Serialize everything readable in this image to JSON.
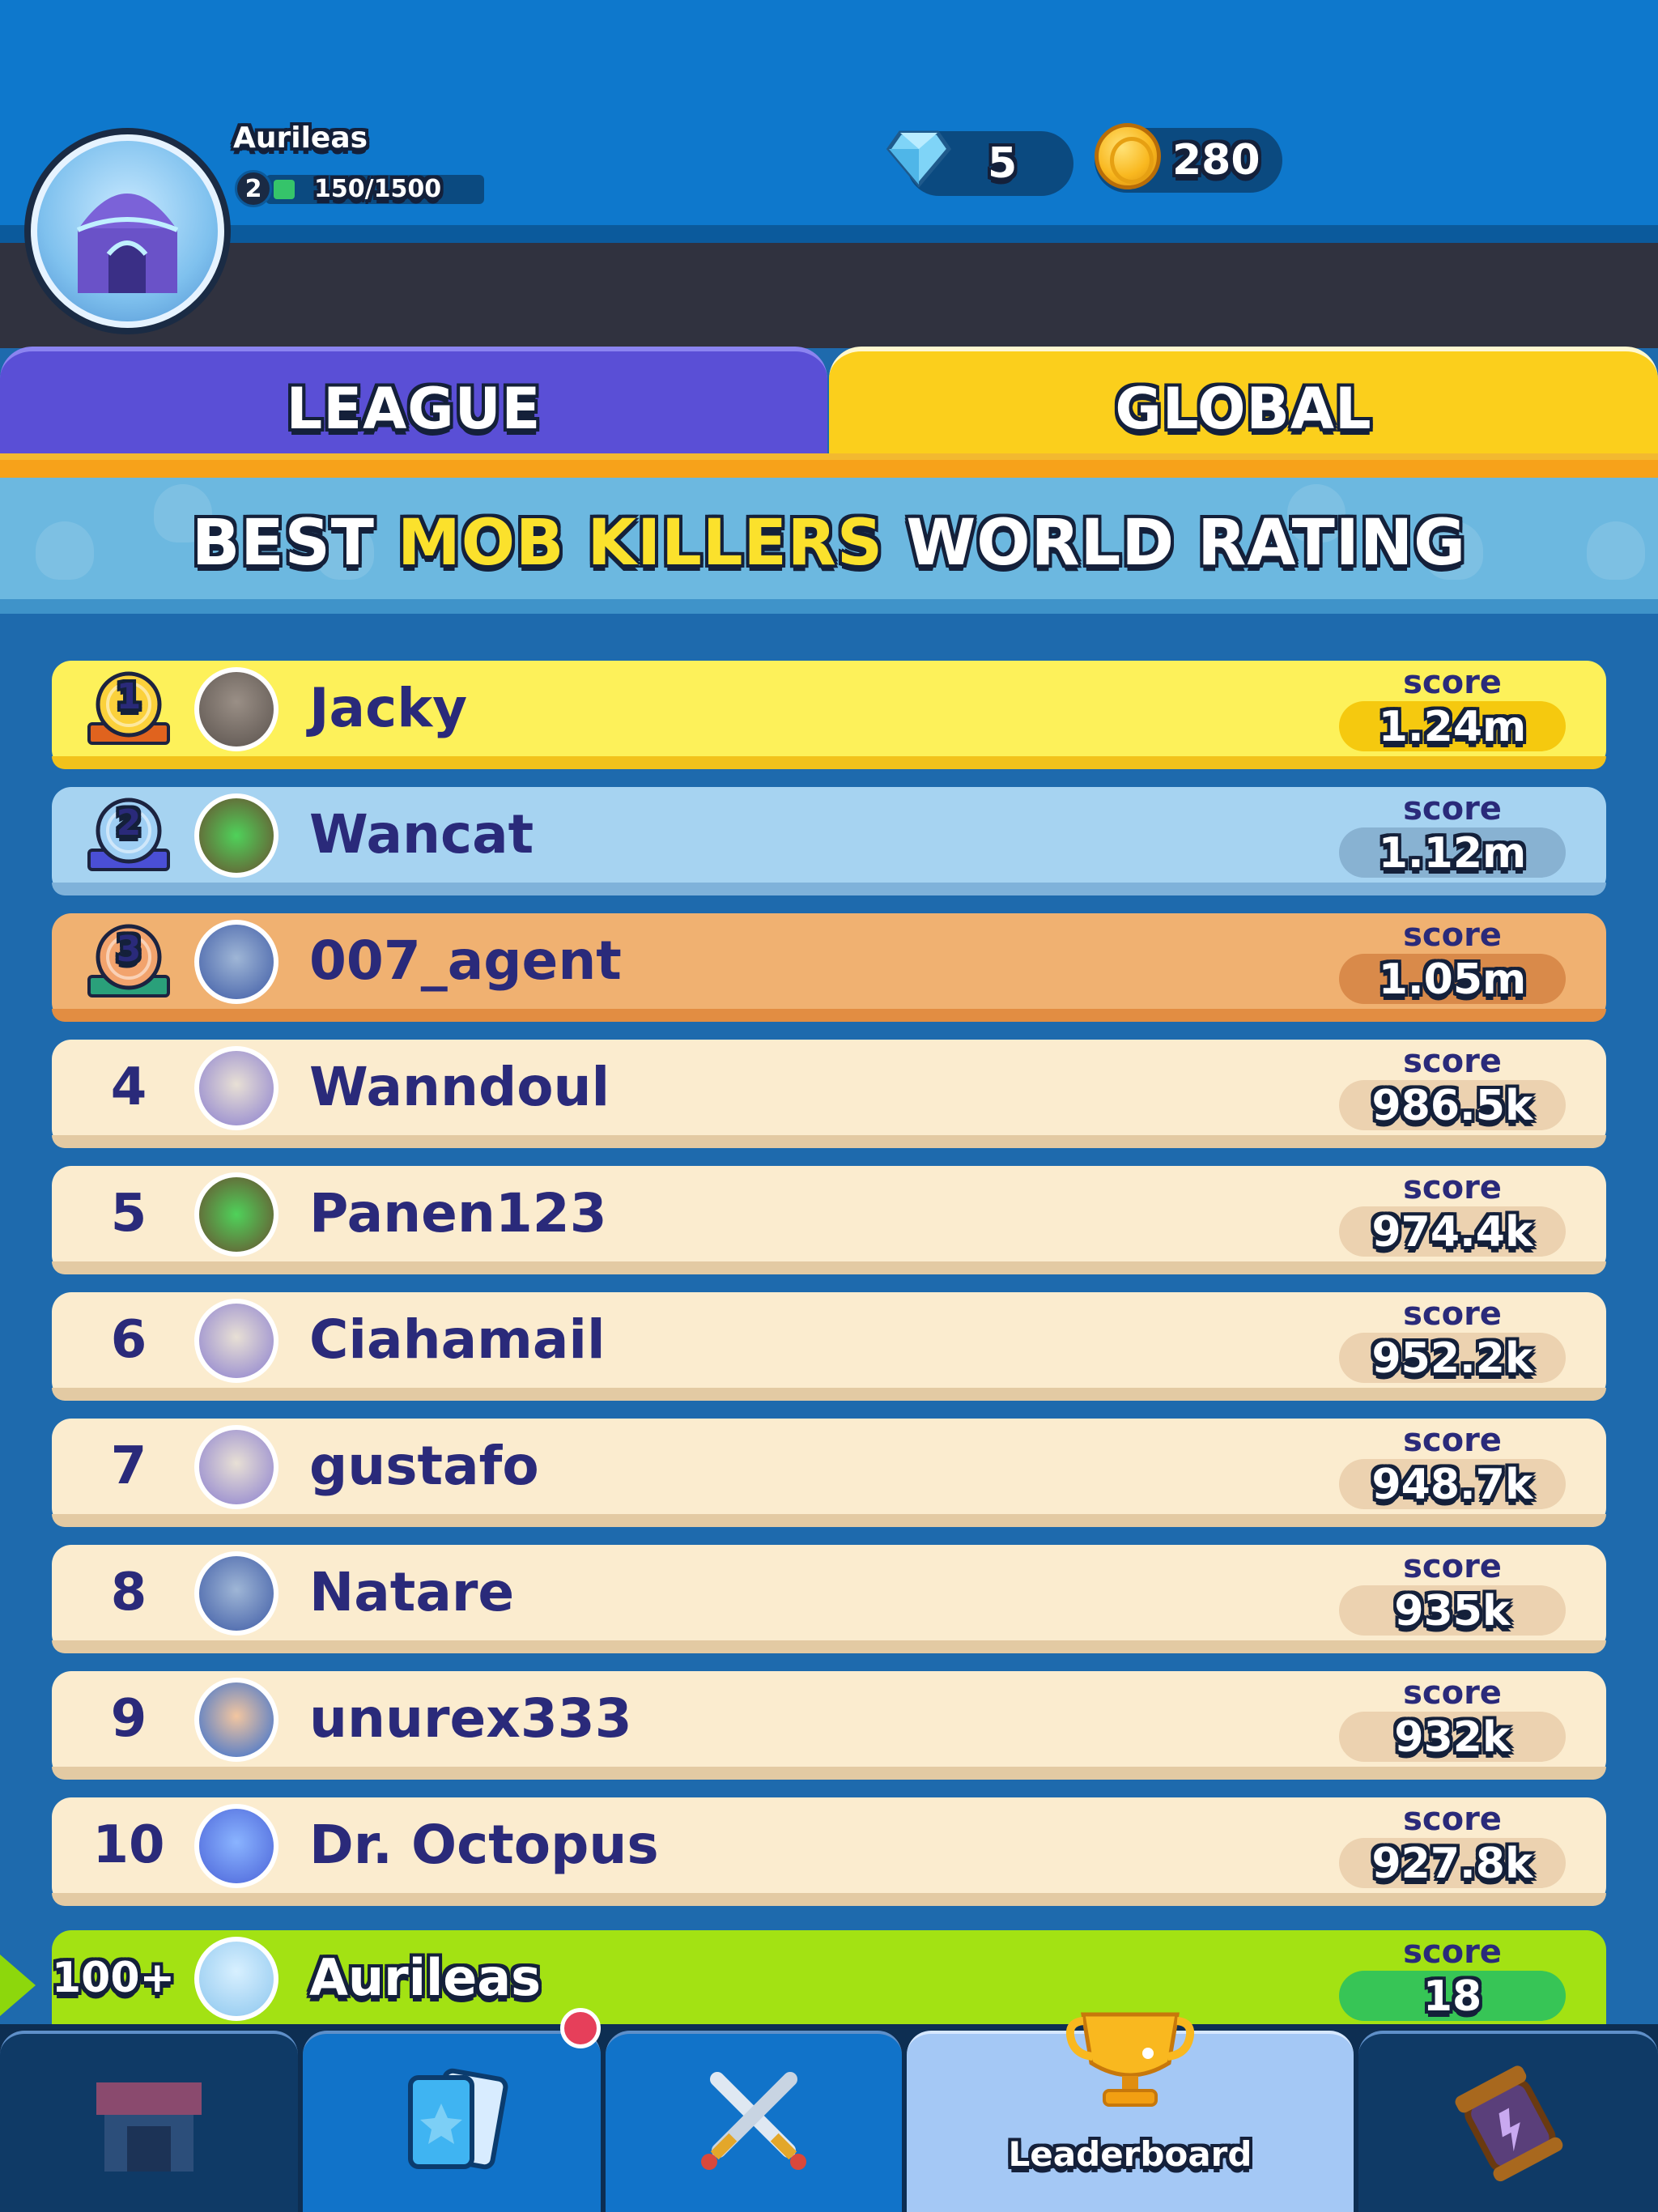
{
  "player": {
    "name": "Aurileas",
    "level": "2",
    "xp_text": "150/1500",
    "xp_progress": 0.1
  },
  "currency": {
    "gems": "5",
    "coins": "280"
  },
  "tabs": {
    "league": "LEAGUE",
    "global": "GLOBAL",
    "active": "global"
  },
  "banner": {
    "part1": "BEST",
    "highlight": "MOB KILLERS",
    "part2": "WORLD RATING"
  },
  "score_label": "score",
  "rows": [
    {
      "rank": "1",
      "name": "Jacky",
      "score": "1.24m",
      "avatar": "tower-avatar-icon"
    },
    {
      "rank": "2",
      "name": "Wancat",
      "score": "1.12m",
      "avatar": "chameleon-avatar-icon"
    },
    {
      "rank": "3",
      "name": "007_agent",
      "score": "1.05m",
      "avatar": "knight-avatar-icon"
    },
    {
      "rank": "4",
      "name": "Wanndoul",
      "score": "986.5k",
      "avatar": "scientist-avatar-icon"
    },
    {
      "rank": "5",
      "name": "Panen123",
      "score": "974.4k",
      "avatar": "chameleon-avatar-icon"
    },
    {
      "rank": "6",
      "name": "Ciahamail",
      "score": "952.2k",
      "avatar": "scientist-avatar-icon"
    },
    {
      "rank": "7",
      "name": "gustafo",
      "score": "948.7k",
      "avatar": "scientist-avatar-icon"
    },
    {
      "rank": "8",
      "name": "Natare",
      "score": "935k",
      "avatar": "knight-avatar-icon"
    },
    {
      "rank": "9",
      "name": "unurex333",
      "score": "932k",
      "avatar": "pirate-avatar-icon"
    },
    {
      "rank": "10",
      "name": "Dr. Octopus",
      "score": "927.8k",
      "avatar": "octopus-avatar-icon"
    }
  ],
  "me": {
    "rank": "100+",
    "name": "Aurileas",
    "score": "18"
  },
  "nav": {
    "leaderboard_label": "Leaderboard",
    "active": "leaderboard"
  },
  "colors": {
    "gold_row": "#fdf15a",
    "silver_row": "#a6d3f1",
    "bronze_row": "#f0b171",
    "default_row": "#fbeccf",
    "me_row": "#a3e213",
    "tab_league": "#5a4fd6",
    "tab_global": "#fbcf1c"
  }
}
